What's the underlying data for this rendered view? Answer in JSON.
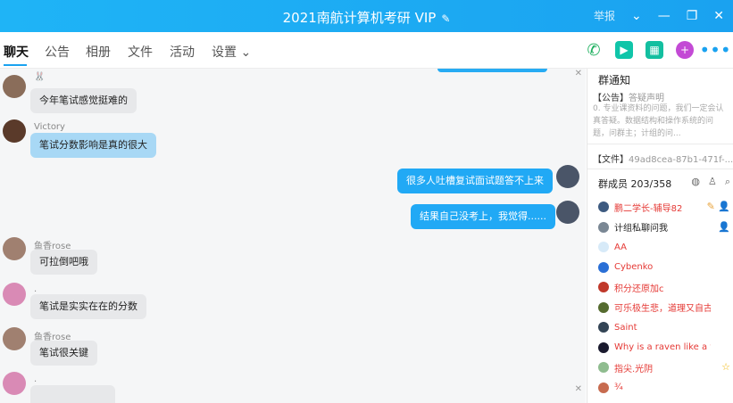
{
  "window": {
    "title": "2021南航计算机考研 VIP",
    "edit_icon": "pencil-icon",
    "report_label": "举报",
    "controls": [
      "chevron-down-icon",
      "minimize-icon",
      "restore-icon",
      "close-icon"
    ]
  },
  "tabs": [
    {
      "label": "聊天",
      "active": true
    },
    {
      "label": "公告"
    },
    {
      "label": "相册"
    },
    {
      "label": "文件"
    },
    {
      "label": "活动"
    },
    {
      "label": "设置 ⌄"
    }
  ],
  "tools": [
    "phone-icon",
    "video-icon",
    "whiteboard-icon",
    "plus-app-icon",
    "more-icon"
  ],
  "messages": [
    {
      "sender": "🐰",
      "text": "今年笔试感觉挺难的",
      "dir": "in"
    },
    {
      "sender": "Victory",
      "text": "笔试分数影响是真的很大",
      "dir": "in-blue"
    },
    {
      "sender": "",
      "text": "很多人吐槽复试面试题答不上来",
      "dir": "out"
    },
    {
      "sender": "",
      "text": "结果自己没考上，我觉得......",
      "dir": "out"
    },
    {
      "sender": "鱼香rose",
      "text": "可拉倒吧哦",
      "dir": "in"
    },
    {
      "sender": ".",
      "text": "笔试是实实在在的分数",
      "dir": "in"
    },
    {
      "sender": "鱼香rose",
      "text": "笔试很关键",
      "dir": "in"
    },
    {
      "sender": ".",
      "text": "",
      "dir": "in"
    }
  ],
  "notice": {
    "heading": "群通知",
    "tag": "【公告】",
    "title": "答疑声明",
    "body": "0. 专业课资料的问题，我们一定会认真答疑。数据结构和操作系统的问题，问群主；计组的问..."
  },
  "file": {
    "tag": "【文件】",
    "name": "49ad8cea-87b1-471f-..."
  },
  "members_header": {
    "label": "群成员 203/358"
  },
  "members": [
    {
      "name": "鹏二学长-辅导82",
      "color": "#e53935",
      "badge": "✎  👤"
    },
    {
      "name": "计组私聊问我",
      "color": "#222",
      "badge": "👤"
    },
    {
      "name": "AA",
      "color": "#e53935",
      "badge": ""
    },
    {
      "name": "Cybenko",
      "color": "#e53935",
      "badge": ""
    },
    {
      "name": "积分还原加c",
      "color": "#e53935",
      "badge": ""
    },
    {
      "name": "可乐极生悲，道理又自古",
      "color": "#e53935",
      "badge": ""
    },
    {
      "name": "Saint",
      "color": "#e53935",
      "badge": ""
    },
    {
      "name": "Why is a raven like a writing desk",
      "color": "#e53935",
      "badge": ""
    },
    {
      "name": "指尖.光阴",
      "color": "#e53935",
      "badge": "☆"
    },
    {
      "name": "¾",
      "color": "#e53935",
      "badge": ""
    }
  ],
  "colors": {
    "accent": "#1aa2f0",
    "outgoing_bubble": "#21a9f5",
    "member_red": "#e53935"
  }
}
